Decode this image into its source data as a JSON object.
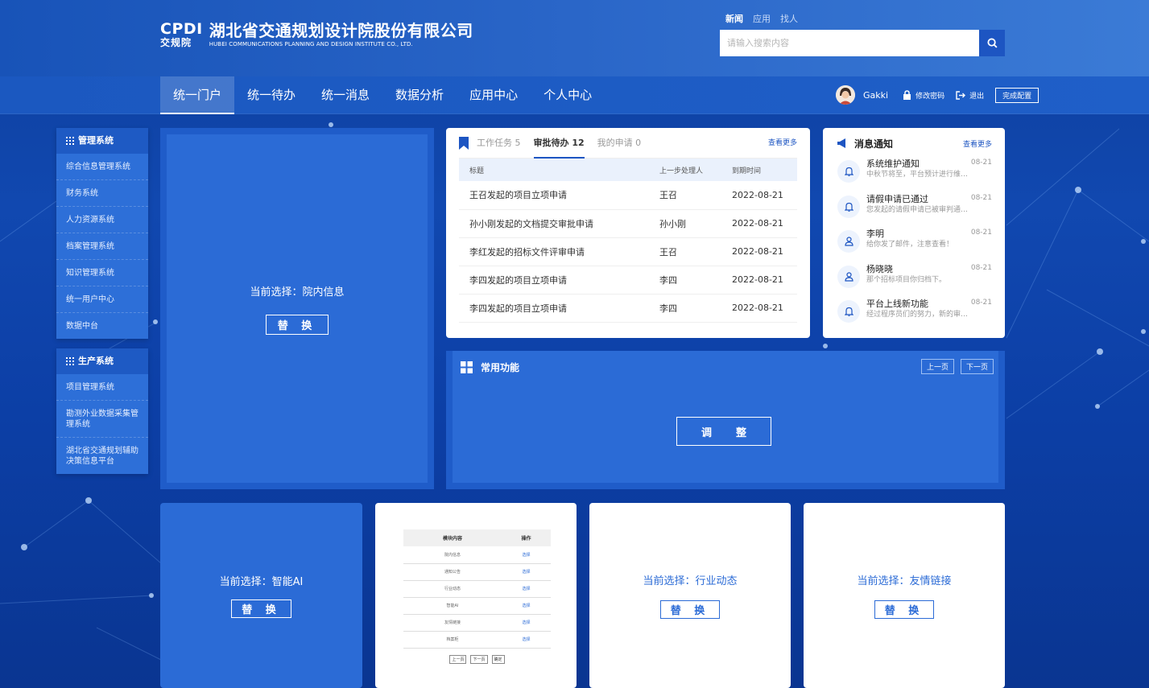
{
  "brand": {
    "mark": "CPDI",
    "mark_cn": "交规院",
    "name_cn": "湖北省交通规划设计院股份有限公司",
    "name_en": "HUBEI COMMUNICATIONS PLANNING AND DESIGN INSTITUTE CO., LTD."
  },
  "search": {
    "tabs": [
      "新闻",
      "应用",
      "找人"
    ],
    "active_tab": "新闻",
    "placeholder": "请输入搜索内容"
  },
  "nav": {
    "items": [
      "统一门户",
      "统一待办",
      "统一消息",
      "数据分析",
      "应用中心",
      "个人中心"
    ],
    "active": "统一门户",
    "user": "Gakki",
    "change_password": "修改密码",
    "logout": "退出",
    "done_config": "完成配置"
  },
  "sidebar": {
    "management": {
      "title": "管理系统",
      "items": [
        "综合信息管理系统",
        "财务系统",
        "人力资源系统",
        "档案管理系统",
        "知识管理系统",
        "统一用户中心",
        "数据中台"
      ]
    },
    "production": {
      "title": "生产系统",
      "items": [
        "项目管理系统",
        "勘测外业数据采集管理系统",
        "湖北省交通规划辅助决策信息平台"
      ]
    }
  },
  "cards": {
    "main_selection": "当前选择：院内信息",
    "replace_label": "替 换",
    "ai_selection": "当前选择：智能AI",
    "industry_selection": "当前选择：行业动态",
    "links_selection": "当前选择：友情链接"
  },
  "tasks": {
    "tabs": [
      "工作任务 5",
      "审批待办 12",
      "我的申请 0"
    ],
    "active_tab": "审批待办 12",
    "more": "查看更多",
    "columns": [
      "标题",
      "上一步处理人",
      "到期时间"
    ],
    "rows": [
      [
        "王召发起的项目立项申请",
        "王召",
        "2022-08-21"
      ],
      [
        "孙小刚发起的文档提交审批申请",
        "孙小刚",
        "2022-08-21"
      ],
      [
        "李红发起的招标文件评审申请",
        "王召",
        "2022-08-21"
      ],
      [
        "李四发起的项目立项申请",
        "李四",
        "2022-08-21"
      ],
      [
        "李四发起的项目立项申请",
        "李四",
        "2022-08-21"
      ]
    ]
  },
  "notices": {
    "title": "消息通知",
    "more": "查看更多",
    "items": [
      {
        "icon": "bell-icon",
        "title": "系统维护通知",
        "desc": "中秋节将至，平台预计进行维护...",
        "date": "08-21"
      },
      {
        "icon": "bell-icon",
        "title": "请假申请已通过",
        "desc": "您发起的请假申请已被审判通过，...",
        "date": "08-21"
      },
      {
        "icon": "user-icon",
        "title": "李明",
        "desc": "给你发了邮件，注意查看！",
        "date": "08-21"
      },
      {
        "icon": "user-icon",
        "title": "杨晓晓",
        "desc": "那个招标项目你归档下。",
        "date": "08-21"
      },
      {
        "icon": "bell-icon",
        "title": "平台上线新功能",
        "desc": "经过程序员们的努力，新的审批功...",
        "date": "08-21"
      }
    ]
  },
  "common": {
    "title": "常用功能",
    "prev": "上一页",
    "next": "下一页",
    "adjust": "调整"
  },
  "mini_table": {
    "columns": [
      "模块内容",
      "操作"
    ],
    "rows": [
      [
        "院内信息",
        "选择"
      ],
      [
        "通知公告",
        "选择"
      ],
      [
        "行业动态",
        "选择"
      ],
      [
        "智能AI",
        "选择"
      ],
      [
        "友情链接",
        "选择"
      ],
      [
        "档案柜",
        "选择"
      ]
    ],
    "pager": [
      "上一页",
      "下一页",
      "确定"
    ]
  },
  "colors": {
    "primary": "#1d55c2",
    "card_blue": "#2b6bd6"
  }
}
